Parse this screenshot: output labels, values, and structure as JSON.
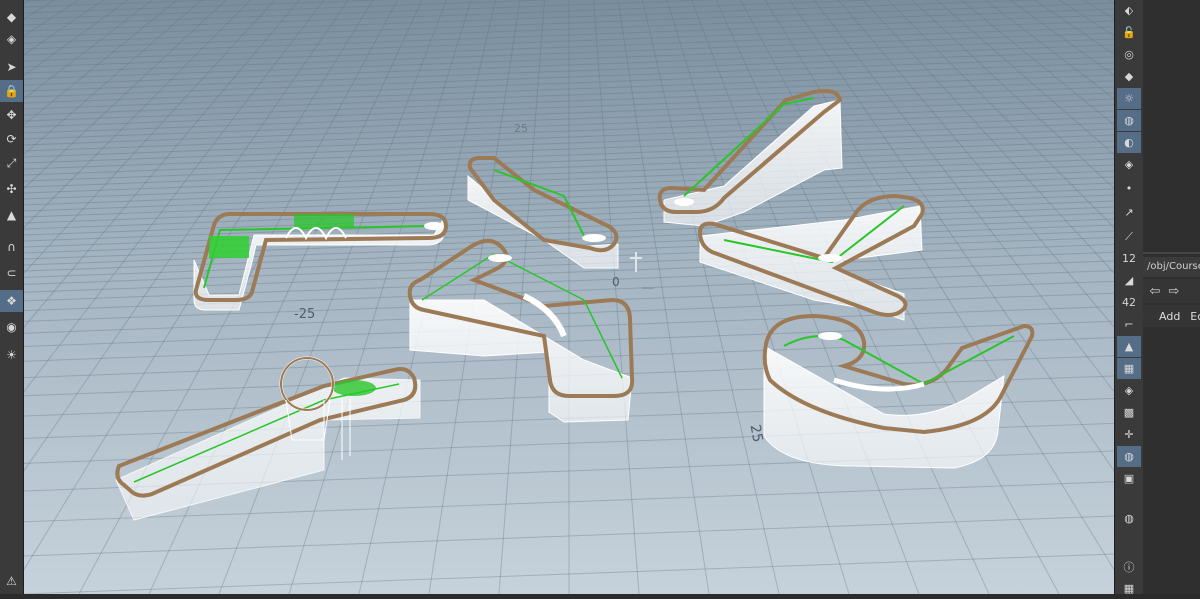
{
  "viewport": {
    "grid_labels": [
      {
        "text": "-25"
      },
      {
        "text": "25"
      },
      {
        "text": "0"
      },
      {
        "text": "25"
      }
    ]
  },
  "left_toolbar": {
    "tools": [
      {
        "name": "edit-node-icon",
        "glyph": "◆"
      },
      {
        "name": "shelf-icon",
        "glyph": "◈"
      },
      {
        "name": "select-arrow-icon",
        "glyph": "➤"
      },
      {
        "name": "lock-icon",
        "glyph": "🔒"
      },
      {
        "name": "transform-icon",
        "glyph": "✥"
      },
      {
        "name": "rotate-icon",
        "glyph": "⟳"
      },
      {
        "name": "scale-icon",
        "glyph": "⤢"
      },
      {
        "name": "pose-icon",
        "glyph": "✣"
      },
      {
        "name": "handle-icon",
        "glyph": "▲"
      },
      {
        "name": "magnet-icon",
        "glyph": "∩"
      },
      {
        "name": "snap-icon",
        "glyph": "⊂"
      },
      {
        "name": "group-icon",
        "glyph": "❖"
      },
      {
        "name": "camera-icon",
        "glyph": "◉"
      },
      {
        "name": "light-icon",
        "glyph": "☀"
      },
      {
        "name": "bottom-warning-icon",
        "glyph": "⚠"
      }
    ]
  },
  "right_toolbar": {
    "tools": [
      {
        "name": "pin-icon",
        "glyph": "⬖"
      },
      {
        "name": "lock-view-icon",
        "glyph": "🔓"
      },
      {
        "name": "visibility-icon",
        "glyph": "◎"
      },
      {
        "name": "display-options-icon",
        "glyph": "◆"
      },
      {
        "name": "lighting-icon",
        "glyph": "☼"
      },
      {
        "name": "shading-icon",
        "glyph": "◍"
      },
      {
        "name": "background-icon",
        "glyph": "◐"
      },
      {
        "name": "ghost-icon",
        "glyph": "◈"
      },
      {
        "name": "points-icon",
        "glyph": "•"
      },
      {
        "name": "normals-icon",
        "glyph": "↗"
      },
      {
        "name": "primitives-icon",
        "glyph": "⟋"
      },
      {
        "name": "point-numbers-icon",
        "glyph": "12"
      },
      {
        "name": "vertex-icon",
        "glyph": "◢"
      },
      {
        "name": "prim-numbers-icon",
        "glyph": "42"
      },
      {
        "name": "corner-icon",
        "glyph": "⌐"
      },
      {
        "name": "wireframe-icon",
        "glyph": "▲"
      },
      {
        "name": "texture-icon",
        "glyph": "▦"
      },
      {
        "name": "snap-display-icon",
        "glyph": "◈"
      },
      {
        "name": "uv-icon",
        "glyph": "▩"
      },
      {
        "name": "axis-icon",
        "glyph": "✛"
      },
      {
        "name": "sphere-icon",
        "glyph": "◍"
      },
      {
        "name": "render-icon",
        "glyph": "▣"
      },
      {
        "name": "geo-icon",
        "glyph": "◍"
      },
      {
        "name": "info-icon",
        "glyph": "ⓘ"
      },
      {
        "name": "layout-icon",
        "glyph": "▦"
      }
    ]
  },
  "side_panel": {
    "path_label": "/obj/Course_",
    "nav": {
      "back": "⇦",
      "forward": "⇨"
    },
    "menu": {
      "add": "Add",
      "edit": "Ec"
    }
  }
}
